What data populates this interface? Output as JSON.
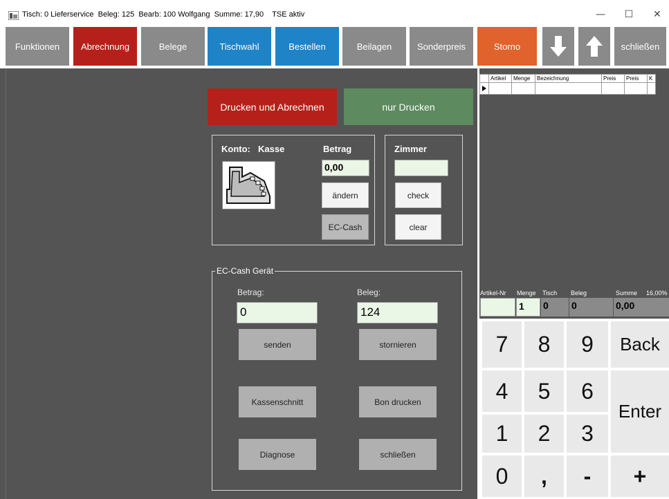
{
  "window": {
    "title": "Tisch: 0 Lieferservice  Beleg: 125  Bearb: 100 Wolfgang  Summe: 17,90    TSE aktiv",
    "minimize": "—",
    "maximize": "☐",
    "close": "✕"
  },
  "toolbar": {
    "funktionen": "Funktionen",
    "abrechnung": "Abrechnung",
    "belege": "Belege",
    "tischwahl": "Tischwahl",
    "bestellen": "Bestellen",
    "beilagen": "Beilagen",
    "sonderpreis": "Sonderpreis",
    "storno": "Storno",
    "schliessen": "schließen",
    "colors": {
      "gray": "#8a8a8a",
      "red": "#b5211a",
      "blue": "#1f83c8",
      "orange": "#e0622c"
    }
  },
  "payment": {
    "drucken_abrechnen": "Drucken und Abrechnen",
    "nur_drucken": "nur Drucken",
    "konto_label": "Konto:",
    "konto_value": "Kasse",
    "betrag_label": "Betrag",
    "betrag_value": "0,00",
    "aendern": "ändern",
    "ec_cash": "EC-Cash",
    "zimmer_label": "Zimmer",
    "zimmer_value": "",
    "check": "check",
    "clear": "clear"
  },
  "ec_device": {
    "group_label": "EC-Cash Gerät",
    "betrag_label": "Betrag:",
    "betrag_value": "0",
    "beleg_label": "Beleg:",
    "beleg_value": "124",
    "senden": "senden",
    "stornieren": "stornieren",
    "kassenschnitt": "Kassenschnitt",
    "bon_drucken": "Bon drucken",
    "diagnose": "Diagnose",
    "schliessen": "schließen"
  },
  "order_grid": {
    "columns": [
      "Artikel",
      "Menge",
      "Bezeichnung",
      "Preis",
      "Preis",
      "K"
    ]
  },
  "summary": {
    "labels": {
      "artikel_nr": "Artikel-Nr",
      "menge": "Menge",
      "tisch": "Tisch",
      "beleg": "Beleg",
      "summe": "Summe",
      "mwst": "16,00%"
    },
    "values": {
      "artikel_nr": "",
      "menge": "1",
      "tisch": "0",
      "beleg": "0",
      "summe": "0,00"
    }
  },
  "keypad": {
    "k7": "7",
    "k8": "8",
    "k9": "9",
    "back": "Back",
    "k4": "4",
    "k5": "5",
    "k6": "6",
    "enter": "Enter",
    "k1": "1",
    "k2": "2",
    "k3": "3",
    "k0": "0",
    "comma": ",",
    "minus": "-",
    "plus": "+"
  }
}
